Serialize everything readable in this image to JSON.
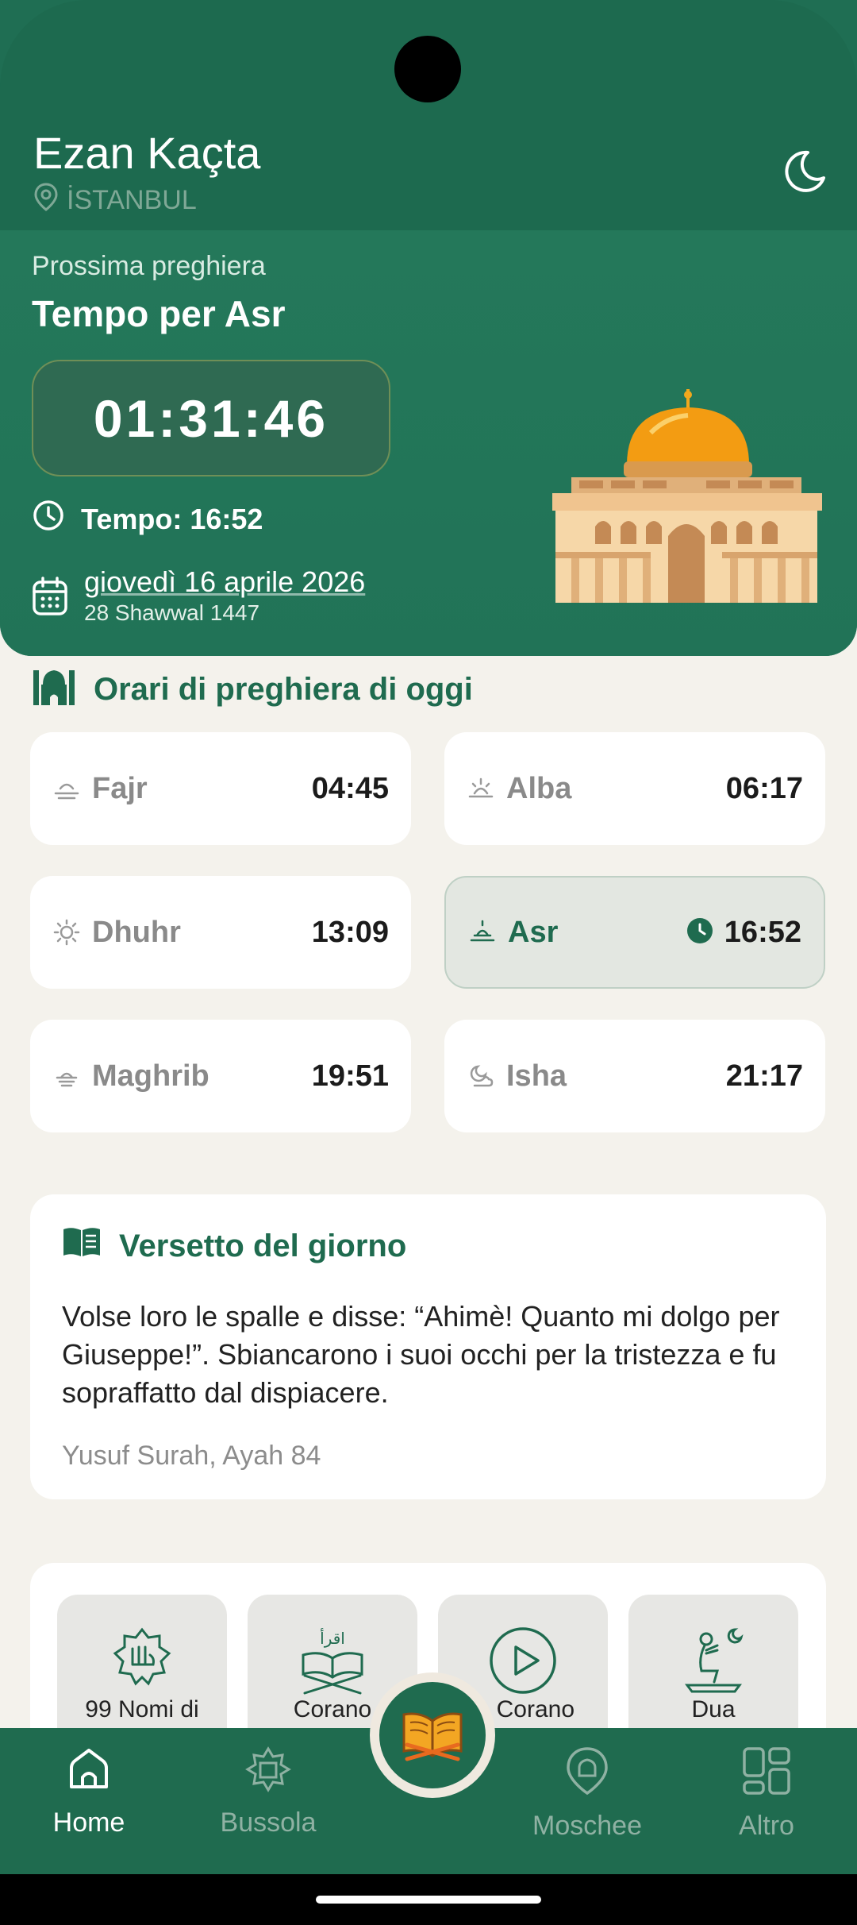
{
  "header": {
    "app_title": "Ezan Kaçta",
    "location": "İSTANBUL",
    "next_label": "Prossima preghiera",
    "next_title": "Tempo per Asr",
    "countdown": "01:31:46",
    "time_label": "Tempo: 16:52",
    "date_gregorian": "giovedì 16 aprile 2026",
    "date_hijri": "28 Shawwal 1447"
  },
  "today": {
    "title": "Orari di preghiera di oggi",
    "prayers": [
      {
        "name": "Fajr",
        "time": "04:45",
        "icon": "fajr-icon",
        "active": false
      },
      {
        "name": "Alba",
        "time": "06:17",
        "icon": "sunrise-icon",
        "active": false
      },
      {
        "name": "Dhuhr",
        "time": "13:09",
        "icon": "sun-icon",
        "active": false
      },
      {
        "name": "Asr",
        "time": "16:52",
        "icon": "asr-icon",
        "active": true
      },
      {
        "name": "Maghrib",
        "time": "19:51",
        "icon": "sunset-icon",
        "active": false
      },
      {
        "name": "Isha",
        "time": "21:17",
        "icon": "moon-cloud-icon",
        "active": false
      }
    ]
  },
  "verse": {
    "title": "Versetto del giorno",
    "text": "Volse loro le spalle e disse: “Ahimè! Quanto mi dolgo per Giuseppe!”. Sbiancarono i suoi occhi per la tristezza e fu sopraffatto dal dispiacere.",
    "reference": "Yusuf Surah, Ayah 84"
  },
  "quick": {
    "tiles": [
      {
        "label": "99 Nomi di",
        "icon": "allah-calligraphy-icon"
      },
      {
        "label": "Corano",
        "icon": "quran-stand-icon"
      },
      {
        "label": "io Corano",
        "icon": "play-icon"
      },
      {
        "label": "Dua",
        "icon": "praying-person-icon"
      }
    ]
  },
  "nav": {
    "home": "Home",
    "compass": "Bussola",
    "mosques": "Moschee",
    "more": "Altro"
  },
  "colors": {
    "primary": "#1f6b4f",
    "header_green": "#217357",
    "background": "#f4f2ec"
  }
}
